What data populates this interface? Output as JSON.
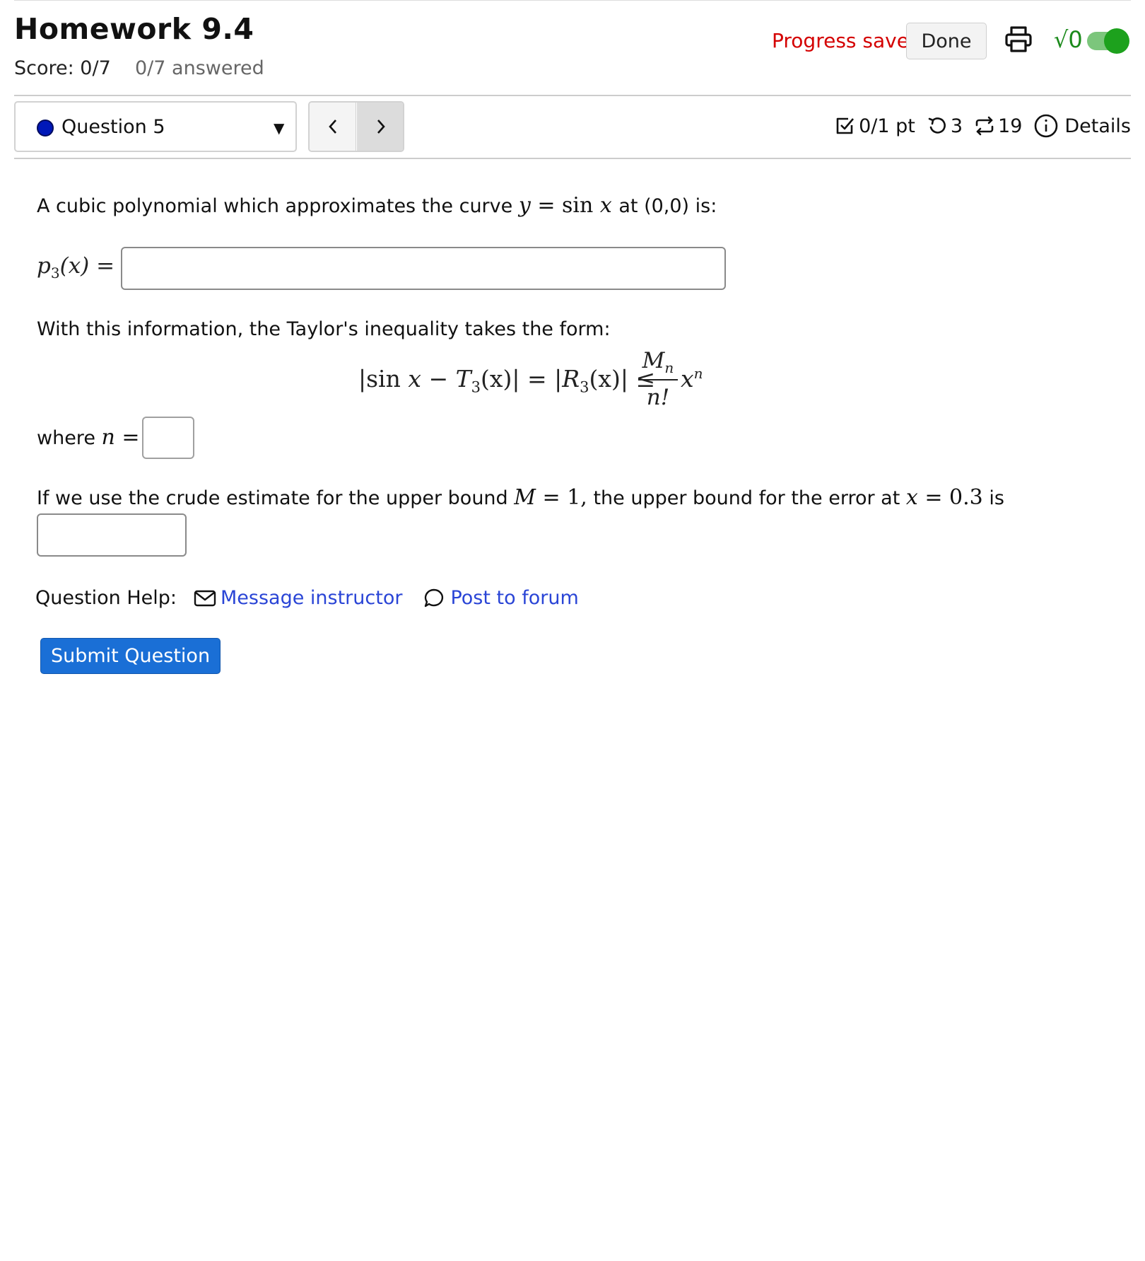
{
  "header": {
    "title": "Homework 9.4",
    "score": "Score: 0/7",
    "answered": "0/7 answered",
    "progress_status": "Progress saved",
    "done_label": "Done",
    "math_toggle_icon": "√0",
    "math_toggle_on": true
  },
  "question_bar": {
    "selected_question": "Question 5",
    "prev_glyph": "<",
    "next_glyph": ">",
    "points": "0/1 pt",
    "retries": "3",
    "attempts": "19",
    "details_label": "Details"
  },
  "question": {
    "intro_text": "A cubic polynomial which approximates the curve",
    "intro_math_y": "y",
    "intro_math_eq": "=",
    "intro_math_sin": "sin",
    "intro_math_x": "x",
    "intro_tail": "at (0,0) is:",
    "p3_label_p": "p",
    "p3_label_sub": "3",
    "p3_label_rest": "(x) =",
    "p3_value": "",
    "taylor_text": "With this information, the Taylor's inequality takes the form:",
    "ineq_lhs_1": "|sin",
    "ineq_lhs_x": "x",
    "ineq_lhs_2": "−",
    "ineq_T": "T",
    "ineq_T_sub": "3",
    "ineq_lhs_3": "(x)| = |",
    "ineq_R": "R",
    "ineq_R_sub": "3",
    "ineq_lhs_4": "(x)| ≤",
    "frac_M": "M",
    "frac_M_sub": "n",
    "frac_den": "n!",
    "tail_x": "x",
    "tail_sup": "n",
    "where_text": "where",
    "where_math_n": "n",
    "where_math_eq": "=",
    "n_value": "",
    "crude_text_1": "If we use the crude estimate for the upper bound",
    "crude_M": "M",
    "crude_eq1": "= 1,",
    "crude_text_2": "the upper bound for the error at",
    "crude_x": "x",
    "crude_eq2": "= 0.3",
    "crude_text_3": "is",
    "err_value": ""
  },
  "help": {
    "label": "Question Help:",
    "message_instructor": "Message instructor",
    "post_to_forum": "Post to forum"
  },
  "submit_label": "Submit Question",
  "colors": {
    "progress_saved": "#d40000",
    "link": "#2a45d6",
    "submit_bg": "#1a6fd6",
    "toggle_on": "#1da11d",
    "question_dot": "#0018b8"
  },
  "icons": {
    "print": "print-icon",
    "points": "checkbox-icon",
    "retry": "undo-icon",
    "attempts": "repeat-icon",
    "details": "info-icon",
    "message": "mail-icon",
    "forum": "chat-bubble-icon"
  }
}
